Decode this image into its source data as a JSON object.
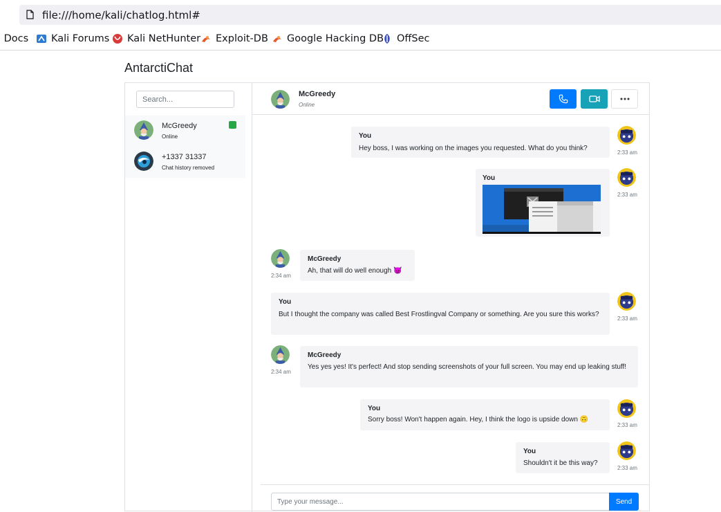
{
  "browser": {
    "url": "file:///home/kali/chatlog.html#",
    "bookmarks": [
      {
        "label": "i Docs",
        "icon": "kali-docs-icon"
      },
      {
        "label": "Kali Forums",
        "icon": "kali-forums-icon"
      },
      {
        "label": "Kali NetHunter",
        "icon": "kali-nethunter-icon"
      },
      {
        "label": "Exploit-DB",
        "icon": "exploit-db-icon"
      },
      {
        "label": "Google Hacking DB",
        "icon": "ghdb-icon"
      },
      {
        "label": "OffSec",
        "icon": "offsec-icon"
      }
    ]
  },
  "app": {
    "title": "AntarctiChat",
    "search_placeholder": "Search..."
  },
  "contacts": [
    {
      "name": "McGreedy",
      "subtitle": "Online",
      "online": true
    },
    {
      "name": "+1337 31337",
      "subtitle": "Chat history removed",
      "online": false
    }
  ],
  "chat_header": {
    "name": "McGreedy",
    "status": "Online"
  },
  "messages": [
    {
      "sender": "You",
      "text": "Hey boss, I was working on the images you requested. What do you think?",
      "time": "2:33 am"
    },
    {
      "sender": "You",
      "text": "",
      "time": "2:33 am",
      "attachment": "screenshot-image"
    },
    {
      "sender": "McGreedy",
      "text": "Ah, that will do well enough 😈",
      "time": "2:34 am"
    },
    {
      "sender": "You",
      "text": "But I thought the company was called Best Frostlingval Company or something. Are you sure this works?",
      "time": "2:33 am"
    },
    {
      "sender": "McGreedy",
      "text": "Yes yes yes! It's perfect! And stop sending screenshots of your full screen. You may end up leaking stuff!",
      "time": "2:34 am"
    },
    {
      "sender": "You",
      "text": "Sorry boss! Won't happen again. Hey, I think the logo is upside down 🙃",
      "time": "2:33 am"
    },
    {
      "sender": "You",
      "text": "Shouldn't it be this way?",
      "time": "2:33 am"
    }
  ],
  "composer": {
    "placeholder": "Type your message...",
    "send_label": "Send"
  },
  "colors": {
    "primary": "#007bff",
    "info": "#17a2b8",
    "online": "#28a745",
    "bubble": "#f4f4f6"
  }
}
